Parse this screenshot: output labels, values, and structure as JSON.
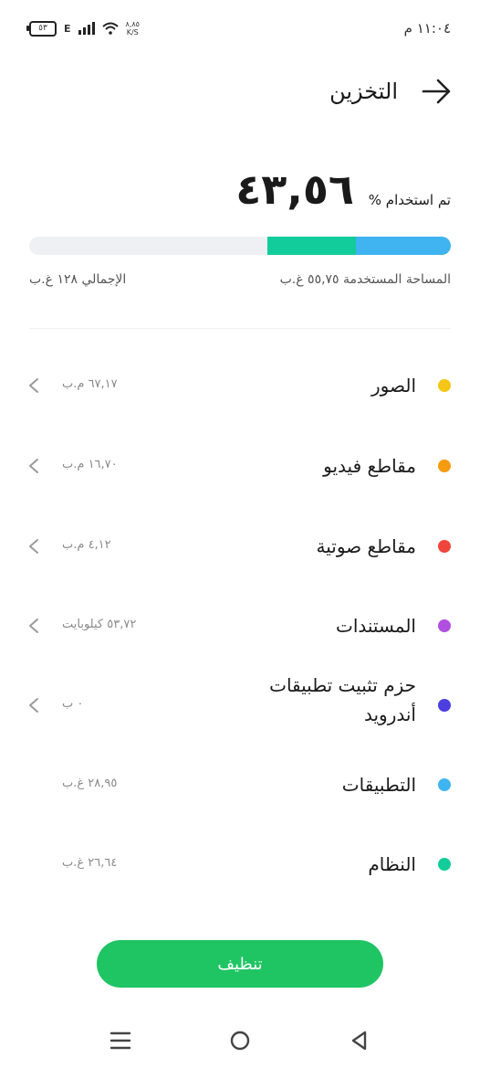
{
  "status_bar": {
    "time": "١١:٠٤ م",
    "battery": "٥٣",
    "network": "E",
    "speed_value": "٨,٨٥",
    "speed_unit": "K/S"
  },
  "header": {
    "title": "التخزين"
  },
  "usage": {
    "label": "تم استخدام %",
    "percent": "٤٣,٥٦",
    "used_label": "المساحة المستخدمة ٥٥,٧٥ غ.ب",
    "total_label": "الإجمالي ١٢٨ غ.ب",
    "bar_segments": [
      {
        "name": "apps",
        "color": "#3fb4f0",
        "fraction": 0.2262
      },
      {
        "name": "system",
        "color": "#12cc9b",
        "fraction": 0.2081
      }
    ]
  },
  "categories": [
    {
      "name": "الصور",
      "size": "٦٧,١٧ م.ب",
      "color": "#f5c518",
      "chevron": true
    },
    {
      "name": "مقاطع فيديو",
      "size": "١٦,٧٠ م.ب",
      "color": "#f59b10",
      "chevron": true
    },
    {
      "name": "مقاطع صوتية",
      "size": "٤,١٢ م.ب",
      "color": "#f0453b",
      "chevron": true
    },
    {
      "name": "المستندات",
      "size": "٥٣,٧٢ كيلوبايت",
      "color": "#b14fe0",
      "chevron": true
    },
    {
      "name": "حزم تثبيت تطبيقات أندرويد",
      "size": "٠ ب",
      "color": "#4b3fe0",
      "chevron": true
    },
    {
      "name": "التطبيقات",
      "size": "٢٨,٩٥ غ.ب",
      "color": "#3fb4f0",
      "chevron": false
    },
    {
      "name": "النظام",
      "size": "٢٦,٦٤ غ.ب",
      "color": "#12cc9b",
      "chevron": false
    }
  ],
  "actions": {
    "clean_label": "تنظيف"
  }
}
